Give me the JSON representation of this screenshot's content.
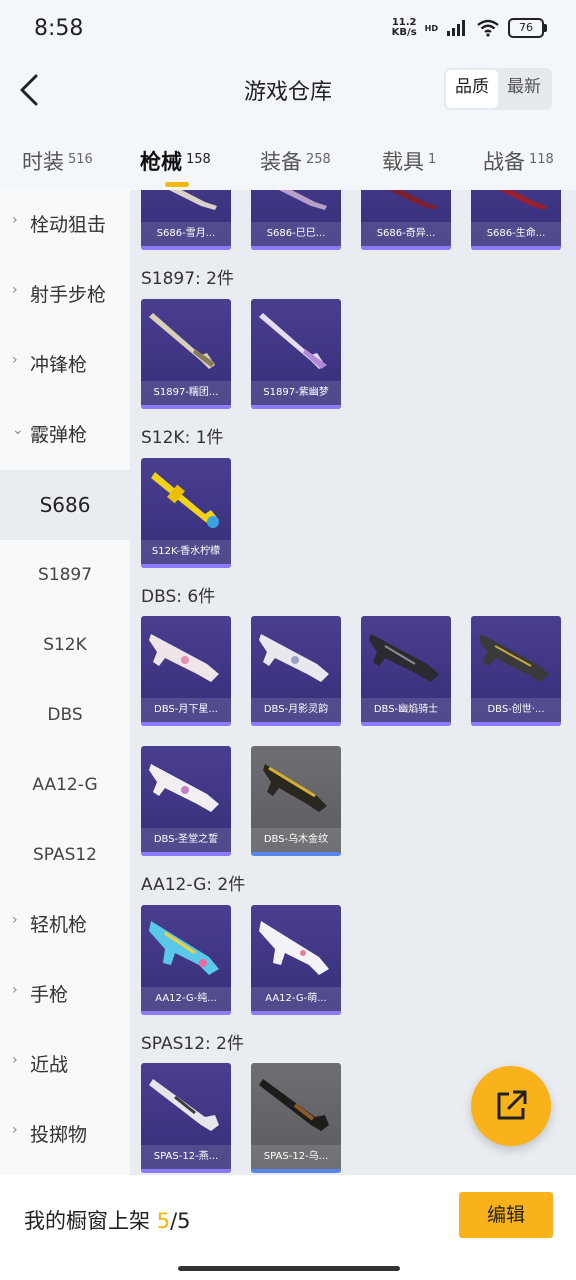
{
  "status": {
    "time": "8:58",
    "net_speed": "11.2",
    "net_unit": "KB/s",
    "hd": "HD",
    "battery": "76"
  },
  "header": {
    "title": "游戏仓库",
    "sort_quality": "品质",
    "sort_newest": "最新"
  },
  "tabs": [
    {
      "label": "时装",
      "count": "516"
    },
    {
      "label": "枪械",
      "count": "158"
    },
    {
      "label": "装备",
      "count": "258"
    },
    {
      "label": "载具",
      "count": "1"
    },
    {
      "label": "战备",
      "count": "118"
    }
  ],
  "sidebar": {
    "categories": [
      "栓动狙击",
      "射手步枪",
      "冲锋枪",
      "霰弹枪",
      "轻机枪",
      "手枪",
      "近战",
      "投掷物"
    ],
    "subs": [
      "S686",
      "S1897",
      "S12K",
      "DBS",
      "AA12-G",
      "SPAS12"
    ]
  },
  "sections": {
    "s686_items": [
      "S686-雪月...",
      "S686-巳巳...",
      "S686-奇异...",
      "S686-生命..."
    ],
    "s1897": {
      "label": "S1897: 2件",
      "items": [
        "S1897-糯团...",
        "S1897-紫幽梦"
      ]
    },
    "s12k": {
      "label": "S12K: 1件",
      "items": [
        "S12K-香水柠檬"
      ]
    },
    "dbs": {
      "label": "DBS: 6件",
      "items": [
        "DBS-月下星...",
        "DBS-月影灵韵",
        "DBS-幽焰骑士",
        "DBS-创世·...",
        "DBS-圣堂之誓",
        "DBS-乌木金纹"
      ]
    },
    "aa12": {
      "label": "AA12-G: 2件",
      "items": [
        "AA12-G-纯...",
        "AA12-G-萌..."
      ]
    },
    "spas12": {
      "label": "SPAS12: 2件",
      "items": [
        "SPAS-12-燕...",
        "SPAS-12-乌..."
      ]
    }
  },
  "bottom": {
    "label": "我的橱窗上架",
    "current": "5",
    "total": "/5",
    "edit": "编辑"
  },
  "colors": {
    "accent": "#f9b21a",
    "card_purple": "#3d3482",
    "card_grey": "#5a5a5f"
  }
}
